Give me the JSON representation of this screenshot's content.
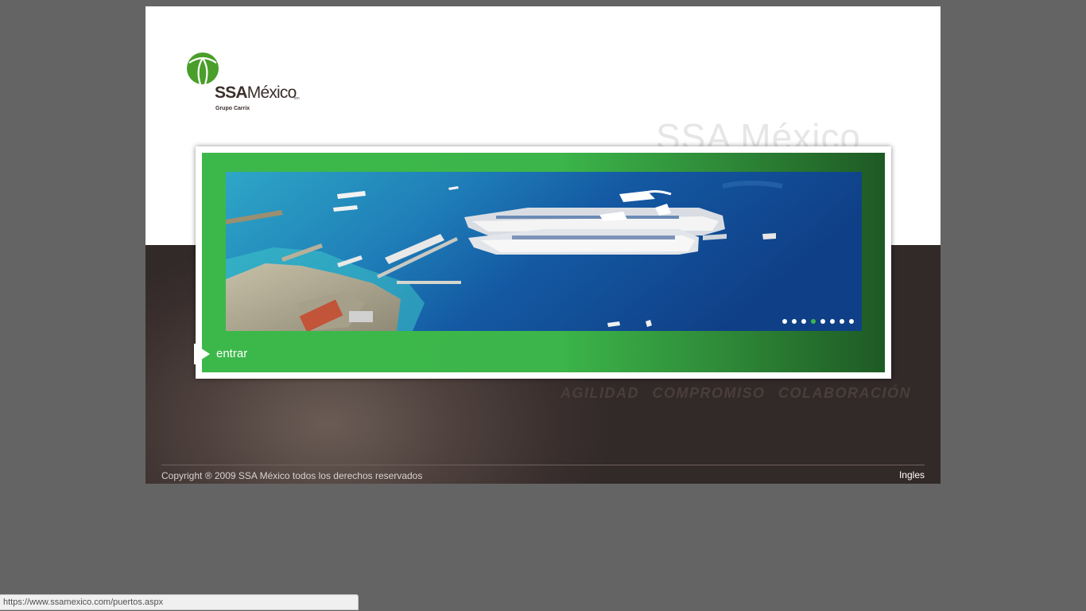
{
  "brand": {
    "name_bold": "SSA",
    "name_regular": "México",
    "tm": "sm",
    "subtitle": "Grupo Carrix",
    "logo_color": "#4a9e2a"
  },
  "watermark": "SSA México",
  "banner": {
    "enter_label": "entrar",
    "slides": 8,
    "active_slide": 4,
    "accent_color": "#3cb84a"
  },
  "slogan": "AGILIDAD COMPROMISO COLABORACIÓN",
  "footer": {
    "copyright": "Copyright ® 2009 SSA México todos los derechos reservados",
    "language_link": "Ingles"
  },
  "status_bar": {
    "url": "https://www.ssamexico.com/puertos.aspx"
  }
}
